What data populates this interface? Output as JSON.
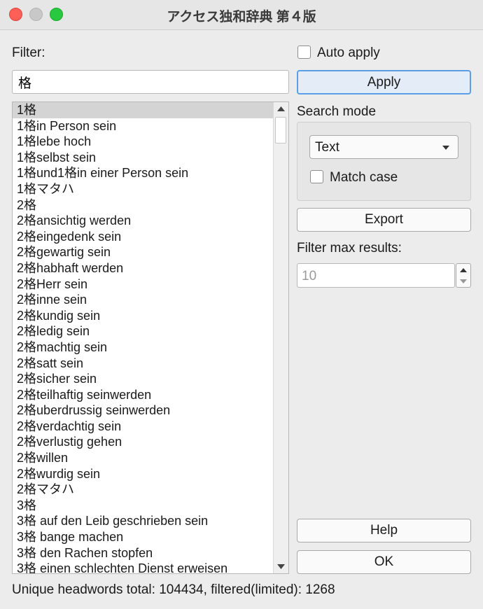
{
  "window": {
    "title": "アクセス独和辞典 第４版"
  },
  "filter": {
    "label": "Filter:",
    "value": "格"
  },
  "auto_apply": {
    "label": "Auto apply",
    "checked": false
  },
  "apply_button": {
    "label": "Apply"
  },
  "search_mode": {
    "label": "Search mode",
    "selected": "Text",
    "match_case_label": "Match case",
    "match_case_checked": false
  },
  "export_button": {
    "label": "Export"
  },
  "filter_max": {
    "label": "Filter max results:",
    "placeholder": "10"
  },
  "help_button": {
    "label": "Help"
  },
  "ok_button": {
    "label": "OK"
  },
  "results": {
    "selected_index": 0,
    "items": [
      "1格",
      "1格in Person sein",
      "1格lebe hoch",
      "1格selbst sein",
      "1格und1格in einer Person sein",
      "1格マタハ",
      "2格",
      "2格ansichtig werden",
      "2格eingedenk sein",
      "2格gewartig sein",
      "2格habhaft werden",
      "2格Herr sein",
      "2格inne sein",
      "2格kundig sein",
      "2格ledig sein",
      "2格machtig sein",
      "2格satt sein",
      "2格sicher sein",
      "2格teilhaftig seinwerden",
      "2格uberdrussig seinwerden",
      "2格verdachtig sein",
      "2格verlustig gehen",
      "2格willen",
      "2格wurdig sein",
      "2格マタハ",
      "3格",
      "3格 auf den Leib geschrieben sein",
      "3格 bange machen",
      "3格 den Rachen stopfen",
      "3格 einen schlechten Dienst erweisen"
    ]
  },
  "status": {
    "text": "Unique headwords total: 104434, filtered(limited): 1268"
  }
}
